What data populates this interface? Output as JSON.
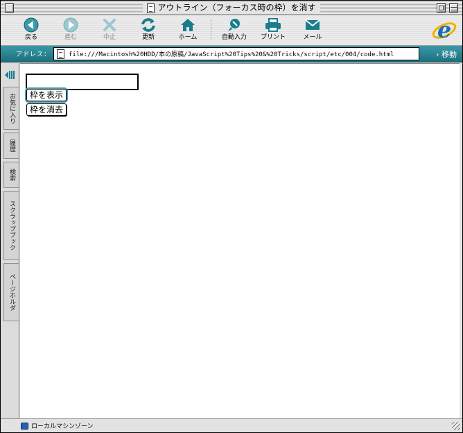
{
  "window": {
    "title": "アウトライン（フォーカス時の枠）を消す"
  },
  "toolbar": {
    "back": "戻る",
    "forward": "進む",
    "stop": "中止",
    "refresh": "更新",
    "home": "ホーム",
    "autofill": "自動入力",
    "print": "プリント",
    "mail": "メール"
  },
  "address": {
    "label": "アドレス：",
    "url": "file:///Macintosh%20HDD/本の原稿/JavaScript%20Tips%20&%20Tricks/script/etc/004/code.html",
    "go": "移動"
  },
  "explorer_tabs": [
    "お気に入り",
    "履歴",
    "検索",
    "スクラップブック",
    "ページホルダ"
  ],
  "page": {
    "input_value": "",
    "show_button": "枠を表示",
    "clear_button": "枠を消去"
  },
  "status": {
    "zone": "ローカルマシンゾーン"
  },
  "colors": {
    "address_bar": "#2a8896",
    "icon_accent": "#1a7d8c"
  }
}
